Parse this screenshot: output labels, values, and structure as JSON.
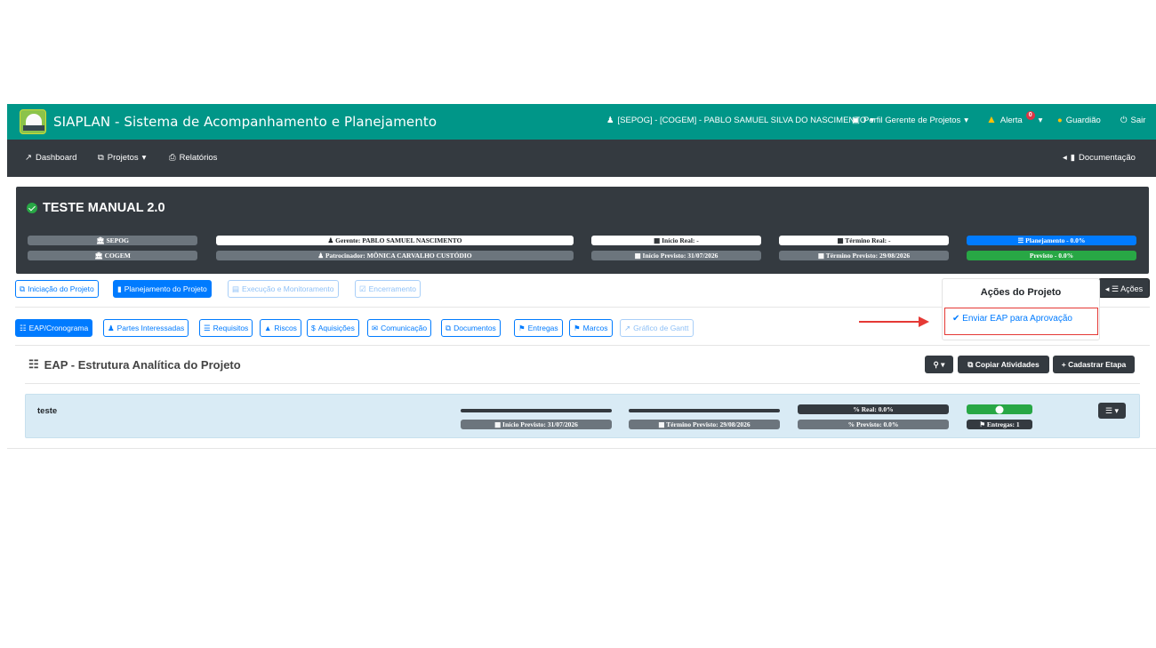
{
  "app": {
    "title": "SIAPLAN - Sistema de Acompanhamento e Planejamento",
    "user": "[SEPOG] - [COGEM] - PABLO SAMUEL SILVA DO NASCIMENTO",
    "profile": "Perfil Gerente de Projetos",
    "alert_label": "Alerta",
    "alert_count": "0",
    "guardian_label": "Guardião",
    "logout_label": "Sair"
  },
  "subnav": {
    "dashboard": "Dashboard",
    "projects": "Projetos",
    "reports": "Relatórios",
    "documentation": "Documentação"
  },
  "project": {
    "name": "TESTE MANUAL 2.0",
    "org1": "SEPOG",
    "org2": "COGEM",
    "manager": "Gerente: PABLO SAMUEL NASCIMENTO",
    "sponsor": "Patrocinador: MÔNICA CARVALHO CUSTÓDIO",
    "start_real": "Início Real: -",
    "start_planned": "Início Previsto: 31/07/2026",
    "end_real": "Término Real: -",
    "end_planned": "Término Previsto: 29/08/2026",
    "phase_status": "Planejamento - 0.0%",
    "planned_status": "Previsto - 0.0%"
  },
  "phase_tabs": [
    {
      "label": "Iniciação do Projeto"
    },
    {
      "label": "Planejamento do Projeto"
    },
    {
      "label": "Execução e Monitoramento"
    },
    {
      "label": "Encerramento"
    }
  ],
  "sub_tabs": [
    {
      "label": "EAP/Cronograma"
    },
    {
      "label": "Partes Interessadas"
    },
    {
      "label": "Requisitos"
    },
    {
      "label": "Riscos"
    },
    {
      "label": "Aquisições"
    },
    {
      "label": "Comunicação"
    },
    {
      "label": "Documentos"
    },
    {
      "label": "Entregas"
    },
    {
      "label": "Marcos"
    },
    {
      "label": "Gráfico de Gantt"
    }
  ],
  "actions": {
    "button_label": "Ações",
    "menu_header": "Ações do Projeto",
    "menu_item": "Enviar EAP para Aprovação"
  },
  "eap": {
    "title": "EAP - Estrutura Analítica do Projeto",
    "copy_label": "Copiar Atividades",
    "add_label": "Cadastrar Etapa"
  },
  "stage": {
    "name": "teste",
    "start_planned": "Início Previsto: 31/07/2026",
    "end_planned": "Término Previsto: 29/08/2026",
    "real_pct": "% Real: 0.0%",
    "planned_pct": "% Previsto: 0.0%",
    "deliveries": "Entregas: 1"
  },
  "colors": {
    "topbar": "#009688",
    "dark": "#343a40",
    "primary": "#007bff",
    "success": "#28a745",
    "annotation": "#e53935"
  }
}
